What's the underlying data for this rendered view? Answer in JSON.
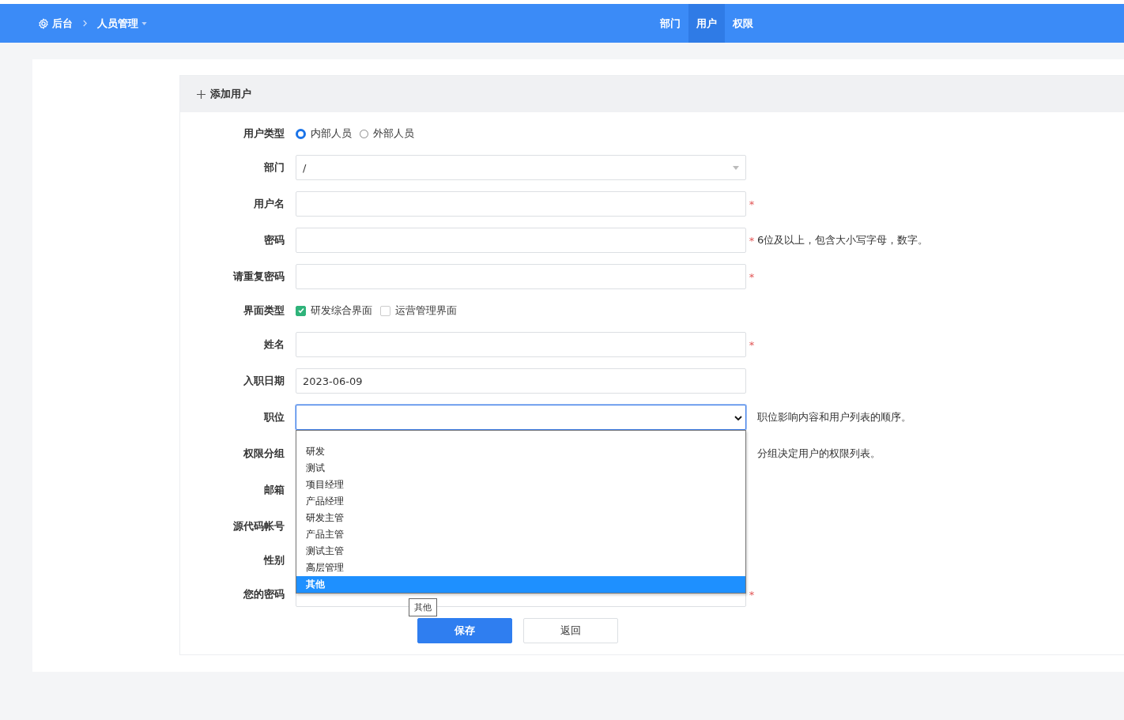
{
  "nav": {
    "home": "后台",
    "section": "人员管理",
    "tabs": [
      {
        "label": "部门",
        "selected": false
      },
      {
        "label": "用户",
        "selected": true
      },
      {
        "label": "权限",
        "selected": false
      }
    ]
  },
  "panel": {
    "title": "添加用户"
  },
  "fields": [
    {
      "kind": "radio",
      "label": "用户类型",
      "options": [
        {
          "label": "内部人员",
          "selected": true
        },
        {
          "label": "外部人员",
          "selected": false
        }
      ]
    },
    {
      "kind": "select",
      "label": "部门",
      "value": "/"
    },
    {
      "kind": "text",
      "label": "用户名",
      "required_mark": "*"
    },
    {
      "kind": "text",
      "label": "密码",
      "required_mark": "*",
      "hint": "6位及以上，包含大小写字母，数字。"
    },
    {
      "kind": "text",
      "label": "请重复密码",
      "required_mark": "*"
    },
    {
      "kind": "checkbox",
      "label": "界面类型",
      "options": [
        {
          "label": "研发综合界面",
          "checked": true
        },
        {
          "label": "运营管理界面",
          "checked": false
        }
      ]
    },
    {
      "kind": "text",
      "label": "姓名",
      "required_mark": "*"
    },
    {
      "kind": "text",
      "label": "入职日期",
      "value": "2023-06-09"
    },
    {
      "kind": "dropdown",
      "label": "职位",
      "hint": "职位影响内容和用户列表的顺序。",
      "tooltip": "其他",
      "options": [
        {
          "label": "研发",
          "selected": false
        },
        {
          "label": "测试",
          "selected": false
        },
        {
          "label": "项目经理",
          "selected": false
        },
        {
          "label": "产品经理",
          "selected": false
        },
        {
          "label": "研发主管",
          "selected": false
        },
        {
          "label": "产品主管",
          "selected": false
        },
        {
          "label": "测试主管",
          "selected": false
        },
        {
          "label": "高层管理",
          "selected": false
        },
        {
          "label": "其他",
          "selected": true
        }
      ]
    },
    {
      "kind": "covered",
      "label": "权限分组",
      "hint": "分组决定用户的权限列表。"
    },
    {
      "kind": "covered",
      "label": "邮箱"
    },
    {
      "kind": "covered",
      "label": "源代码帐号"
    },
    {
      "kind": "covered-short",
      "label": "性别"
    },
    {
      "kind": "text",
      "label": "您的密码",
      "required_mark": "*"
    }
  ],
  "buttons": [
    {
      "label": "保存",
      "kind": "primary"
    },
    {
      "label": "返回",
      "kind": "default"
    }
  ]
}
